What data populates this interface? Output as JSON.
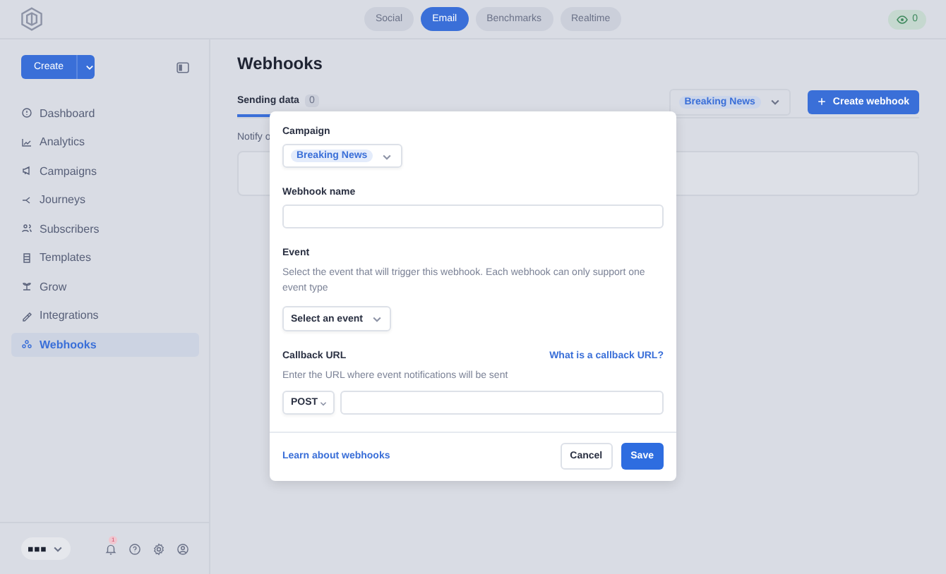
{
  "top_nav": {
    "tabs": [
      {
        "label": "Social",
        "selected": false
      },
      {
        "label": "Email",
        "selected": true
      },
      {
        "label": "Benchmarks",
        "selected": false
      },
      {
        "label": "Realtime",
        "selected": false
      }
    ],
    "viewers": "0"
  },
  "sidebar": {
    "create_button": "Create",
    "items": [
      {
        "label": "Dashboard",
        "selected": false
      },
      {
        "label": "Analytics",
        "selected": false
      },
      {
        "label": "Campaigns",
        "selected": false
      },
      {
        "label": "Journeys",
        "selected": false
      },
      {
        "label": "Subscribers",
        "selected": false
      },
      {
        "label": "Templates",
        "selected": false
      },
      {
        "label": "Grow",
        "selected": false
      },
      {
        "label": "Integrations",
        "selected": false
      },
      {
        "label": "Webhooks",
        "selected": true
      }
    ],
    "notification_count": "1"
  },
  "page": {
    "title": "Webhooks",
    "tabs": [
      {
        "label": "Sending data",
        "count": "0",
        "selected": true
      }
    ],
    "campaign_filter": "Breaking News",
    "create_button": "Create webhook",
    "notice": "Notify o"
  },
  "modal": {
    "campaign": {
      "label": "Campaign",
      "value": "Breaking News"
    },
    "webhook_name": {
      "label": "Webhook name"
    },
    "event": {
      "label": "Event",
      "description": "Select the event that will trigger this webhook. Each webhook can only support one event type",
      "select": "Select an event"
    },
    "callback": {
      "label": "Callback URL",
      "help_link": "What is a callback URL?",
      "description": "Enter the URL where event notifications will be sent",
      "method": "POST"
    },
    "footer": {
      "link": "Learn about webhooks",
      "cancel": "Cancel",
      "save": "Save"
    }
  }
}
